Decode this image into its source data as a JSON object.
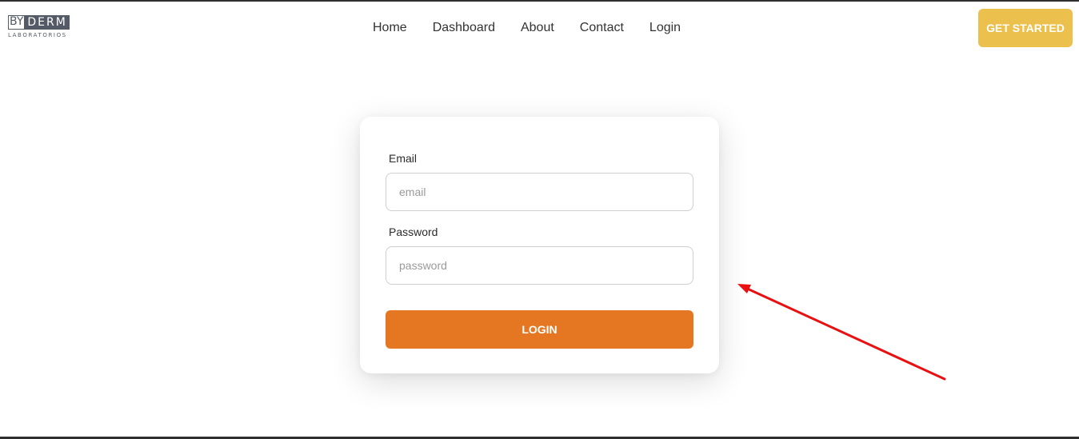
{
  "brand": {
    "logo_by": "BY",
    "logo_derm": "DERM",
    "logo_sub": "LABORATORIOS"
  },
  "nav": {
    "items": [
      {
        "label": "Home"
      },
      {
        "label": "Dashboard"
      },
      {
        "label": "About"
      },
      {
        "label": "Contact"
      },
      {
        "label": "Login"
      }
    ]
  },
  "header": {
    "cta_label": "GET STARTED"
  },
  "login_form": {
    "email_label": "Email",
    "email_placeholder": "email",
    "email_value": "",
    "password_label": "Password",
    "password_placeholder": "password",
    "password_value": "",
    "submit_label": "LOGIN"
  },
  "colors": {
    "accent_orange": "#e67722",
    "cta_yellow": "#ecc04c",
    "annotation_red": "#e81010"
  },
  "annotation": {
    "type": "arrow",
    "color": "red"
  }
}
